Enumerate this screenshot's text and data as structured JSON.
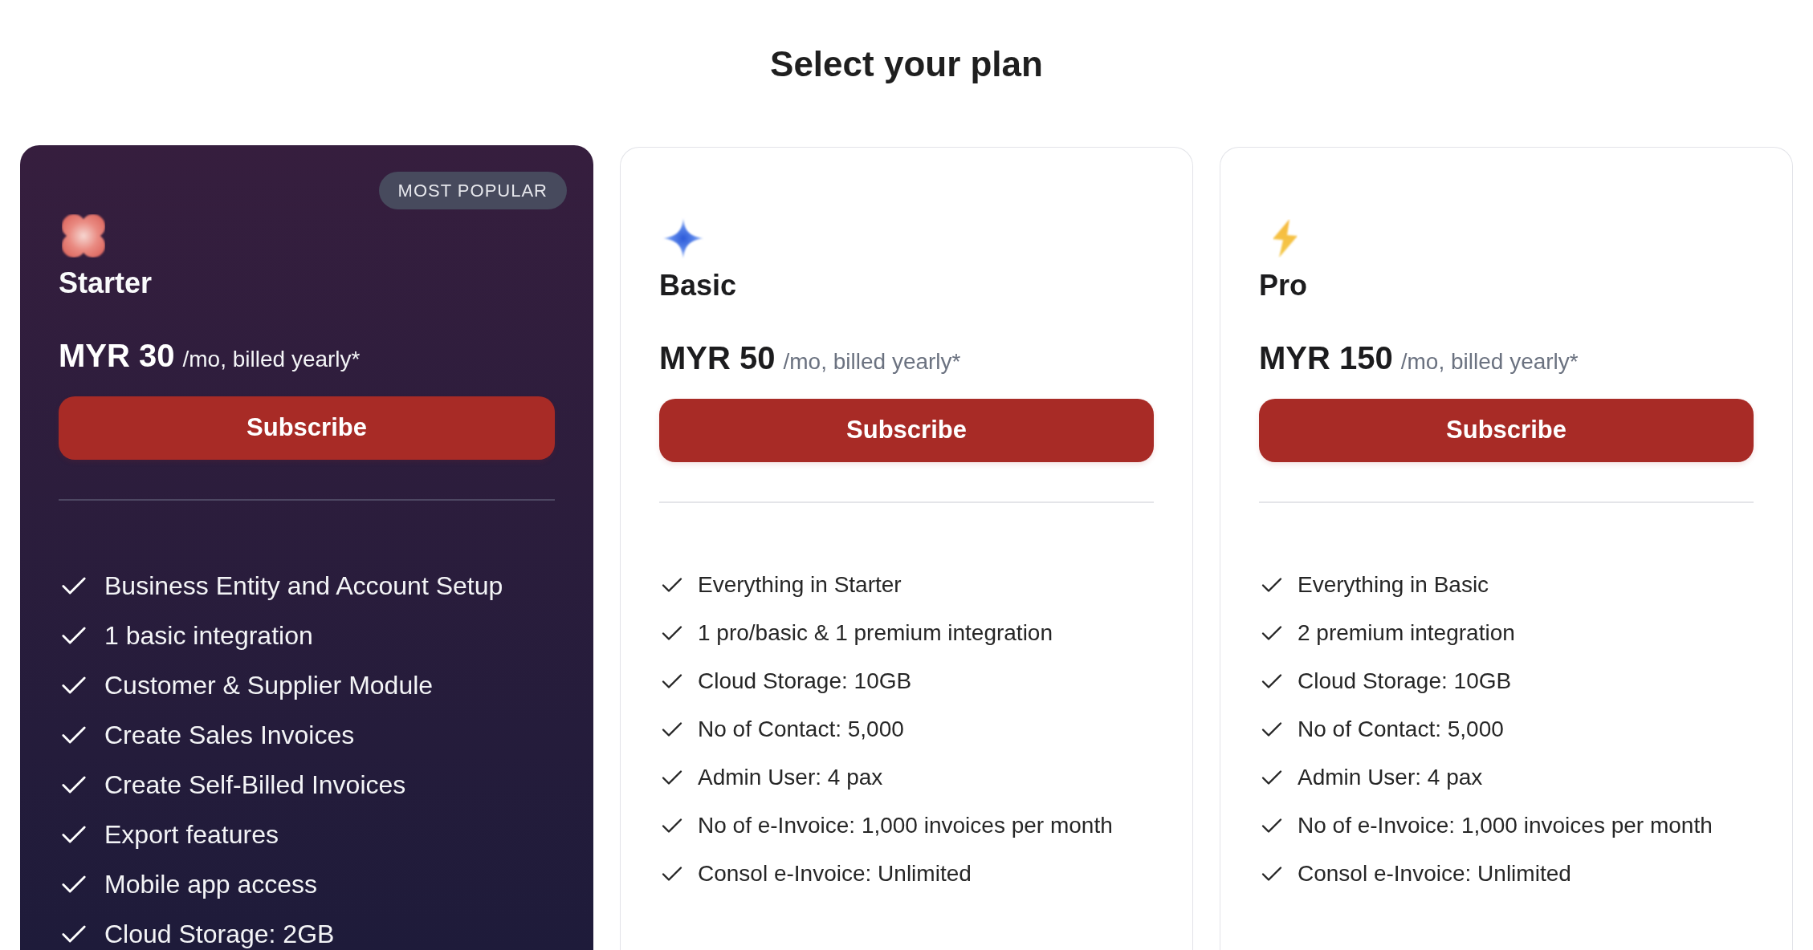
{
  "title": "Select your plan",
  "plans": [
    {
      "name": "Starter",
      "featured": true,
      "badge": "MOST POPULAR",
      "price": "MYR 30",
      "period": "/mo, billed yearly*",
      "button": "Subscribe",
      "features": [
        "Business Entity and Account Setup",
        "1 basic integration",
        "Customer & Supplier Module",
        "Create Sales Invoices",
        "Create Self-Billed Invoices",
        "Export features",
        "Mobile app access",
        "Cloud Storage: 2GB"
      ]
    },
    {
      "name": "Basic",
      "featured": false,
      "price": "MYR 50",
      "period": "/mo, billed yearly*",
      "button": "Subscribe",
      "features": [
        "Everything in Starter",
        "1 pro/basic & 1 premium integration",
        "Cloud Storage: 10GB",
        "No of Contact: 5,000",
        "Admin User: 4 pax",
        "No of e-Invoice: 1,000 invoices per month",
        "Consol e-Invoice: Unlimited"
      ]
    },
    {
      "name": "Pro",
      "featured": false,
      "price": "MYR 150",
      "period": "/mo, billed yearly*",
      "button": "Subscribe",
      "features": [
        "Everything in Basic",
        "2 premium integration",
        "Cloud Storage: 10GB",
        "No of Contact: 5,000",
        "Admin User: 4 pax",
        "No of e-Invoice: 1,000 invoices per month",
        "Consol e-Invoice: Unlimited"
      ]
    }
  ]
}
